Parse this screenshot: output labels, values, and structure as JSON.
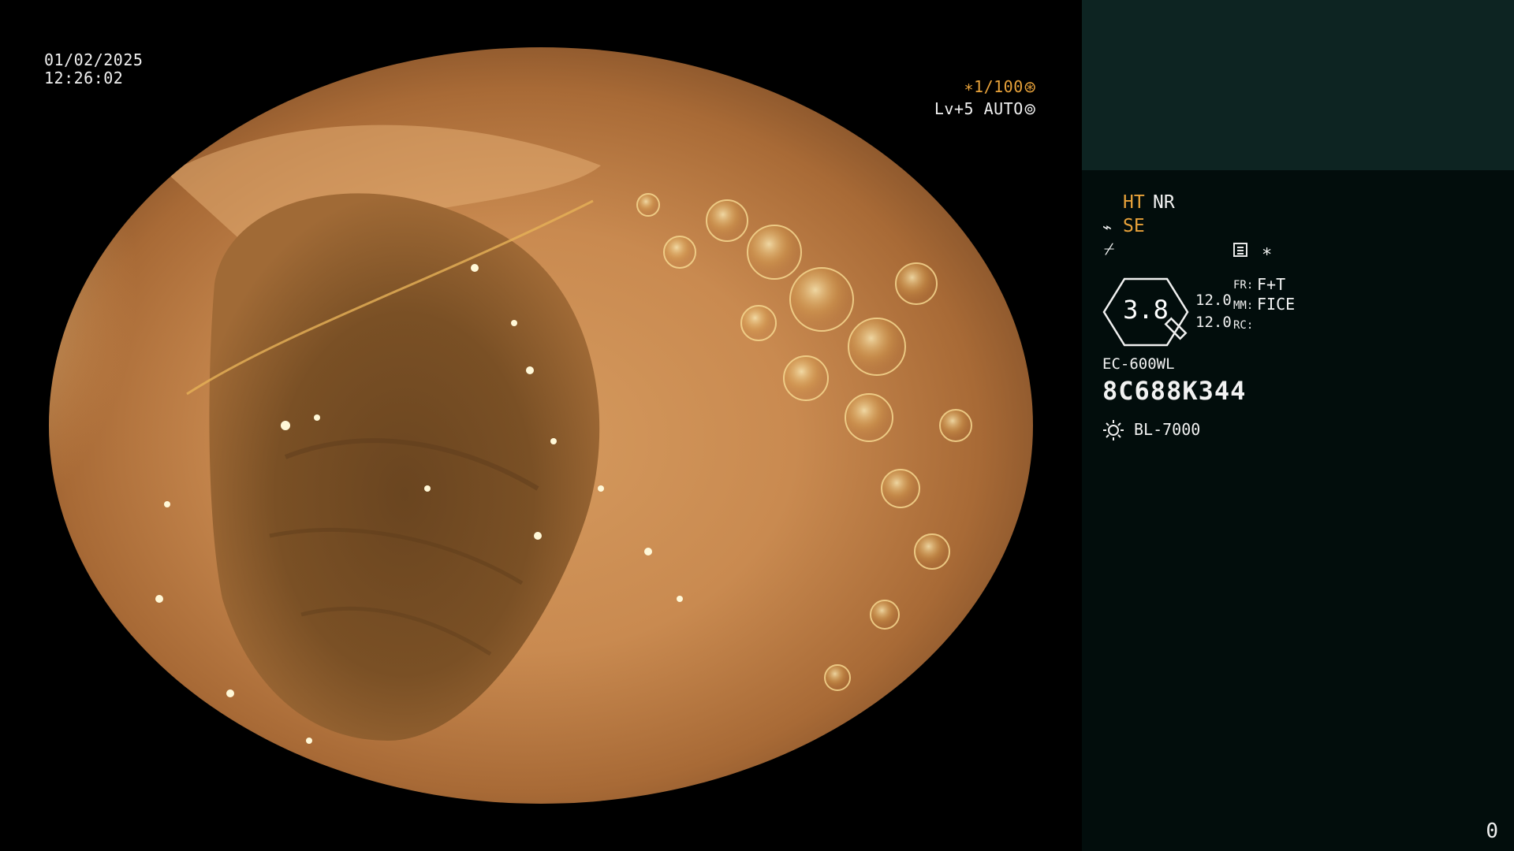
{
  "overlay": {
    "date": "01/02/2025",
    "time": "12:26:02",
    "zoom": "∗1/100",
    "zoom_icon": "aperture-icon",
    "level": "Lv+5 AUTO",
    "level_icon": "iris-icon"
  },
  "panel": {
    "ht": "HT",
    "nr": "NR",
    "se_icon": "wave-icon",
    "se": "SE",
    "slash_icon": "filter-icon",
    "menu_icon": "list-icon",
    "star": "∗",
    "dial_value": "3.8",
    "num1": "12.0",
    "num2": "12.0",
    "fr_label": "FR:",
    "fr_value": "F+T",
    "mm_label": "MM:",
    "mm_value": "FICE",
    "rc_label": "RC:",
    "scope_model": "EC-600WL",
    "scope_serial": "8C688K344",
    "light_icon": "sun-icon",
    "light_source": "BL-7000",
    "counter": "0"
  },
  "colors": {
    "accent_orange": "#e8a23a",
    "panel_top": "#0d2422",
    "panel_bg": "#020d0c"
  }
}
